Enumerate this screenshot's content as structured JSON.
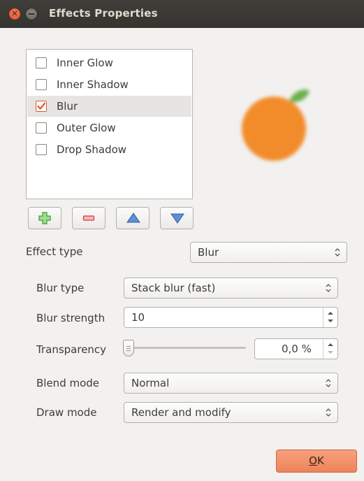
{
  "window": {
    "title": "Effects Properties"
  },
  "effects": [
    {
      "label": "Inner Glow",
      "checked": false
    },
    {
      "label": "Inner Shadow",
      "checked": false
    },
    {
      "label": "Blur",
      "checked": true,
      "selected": true
    },
    {
      "label": "Outer Glow",
      "checked": false
    },
    {
      "label": "Drop Shadow",
      "checked": false
    }
  ],
  "list_buttons": {
    "add_icon": "plus-icon",
    "remove_icon": "minus-icon",
    "up_icon": "arrow-up-icon",
    "down_icon": "arrow-down-icon"
  },
  "effect_type": {
    "label": "Effect type",
    "value": "Blur"
  },
  "blur_type": {
    "label": "Blur type",
    "value": "Stack blur (fast)"
  },
  "blur_strength": {
    "label": "Blur strength",
    "value": "10"
  },
  "transparency": {
    "label": "Transparency",
    "value": "0,0 %",
    "slider_fraction": 0.0
  },
  "blend_mode": {
    "label": "Blend mode",
    "value": "Normal"
  },
  "draw_mode": {
    "label": "Draw mode",
    "value": "Render and modify"
  },
  "ok_button": {
    "mnemonic": "O",
    "rest": "K"
  },
  "colors": {
    "accent": "#ee8458",
    "titlebar": "#3c3b37",
    "preview_fruit": "#f28c2a",
    "preview_leaf": "#6ab04c"
  }
}
